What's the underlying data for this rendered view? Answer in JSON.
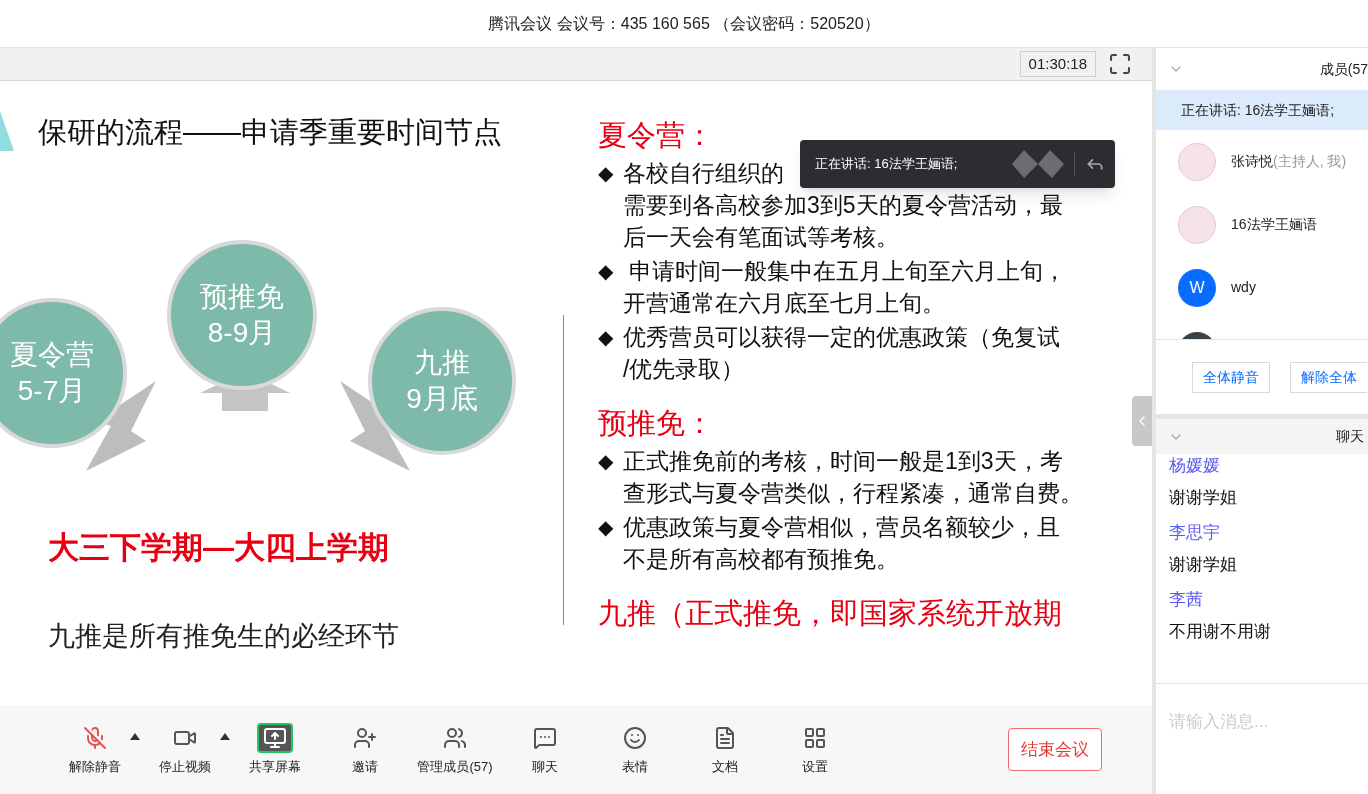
{
  "window": {
    "title": "腾讯会议 会议号：435 160 565 （会议密码：520520）"
  },
  "stage": {
    "timer": "01:30:18"
  },
  "slide": {
    "title": "保研的流程——申请季重要时间节点",
    "nodes": [
      {
        "name": "夏令营",
        "period": "5-7月"
      },
      {
        "name": "预推免",
        "period": "8-9月"
      },
      {
        "name": "九推",
        "period": "9月底"
      }
    ],
    "span": "大三下学期—大四上学期",
    "note": "九推是所有推免生的必经环节",
    "sections": [
      {
        "heading": "夏令营：",
        "bullets": [
          {
            "marker": "◆",
            "lines": [
              "各校自行组织的",
              "需要到各高校参加3到5天的夏令营活动，最",
              "后一天会有笔面试等考核。"
            ]
          },
          {
            "marker": "◆",
            "lines": [
              " 申请时间一般集中在五月上旬至六月上旬，",
              "开营通常在六月底至七月上旬。"
            ]
          },
          {
            "marker": "◆",
            "lines": [
              "优秀营员可以获得一定的优惠政策（免复试",
              "/优先录取）"
            ]
          }
        ]
      },
      {
        "heading": "预推免：",
        "bullets": [
          {
            "marker": "◆",
            "lines": [
              "正式推免前的考核，时间一般是1到3天，考",
              "查形式与夏令营类似，行程紧凑，通常自费。"
            ]
          },
          {
            "marker": "◆",
            "lines": [
              "优惠政策与夏令营相似，营员名额较少，且",
              "不是所有高校都有预推免。"
            ]
          }
        ]
      },
      {
        "heading": "九推（正式推免，即国家系统开放期"
      }
    ]
  },
  "speaking_popup": {
    "text": "正在讲话: 16法学王婳语;"
  },
  "toolbar": {
    "items": [
      {
        "kind": "mic",
        "label": "解除静音",
        "muted": true,
        "caret": true,
        "active": false
      },
      {
        "kind": "video",
        "label": "停止视频",
        "muted": false,
        "caret": true,
        "active": false
      },
      {
        "kind": "share",
        "label": "共享屏幕",
        "muted": false,
        "caret": false,
        "active": true
      },
      {
        "kind": "invite",
        "label": "邀请",
        "muted": false,
        "caret": false,
        "active": false
      },
      {
        "kind": "members",
        "label": "管理成员(57)",
        "muted": false,
        "caret": false,
        "active": false
      },
      {
        "kind": "chat",
        "label": "聊天",
        "muted": false,
        "caret": false,
        "active": false
      },
      {
        "kind": "emoji",
        "label": "表情",
        "muted": false,
        "caret": false,
        "active": false
      },
      {
        "kind": "docs",
        "label": "文档",
        "muted": false,
        "caret": false,
        "active": false
      },
      {
        "kind": "settings",
        "label": "设置",
        "muted": false,
        "caret": false,
        "active": false
      }
    ],
    "end_button": "结束会议"
  },
  "members": {
    "header": "成员(57",
    "speaking": "正在讲话: 16法学王婳语;",
    "list": [
      {
        "kind": "drawing",
        "name": "张诗悦",
        "role": "(主持人, 我)"
      },
      {
        "kind": "drawing",
        "name": "16法学王婳语"
      },
      {
        "kind": "letter",
        "letter": "W",
        "color": "#0a6cff",
        "name": "wdy"
      },
      {
        "kind": "photo"
      }
    ],
    "buttons": [
      "全体静音",
      "解除全体"
    ]
  },
  "chat": {
    "header": "聊天",
    "messages": [
      {
        "sender": "杨媛媛",
        "text": "谢谢学姐"
      },
      {
        "sender": "李思宇",
        "text": "谢谢学姐"
      },
      {
        "sender": "李茜",
        "text": "不用谢不用谢"
      }
    ],
    "placeholder": "请输入消息..."
  }
}
